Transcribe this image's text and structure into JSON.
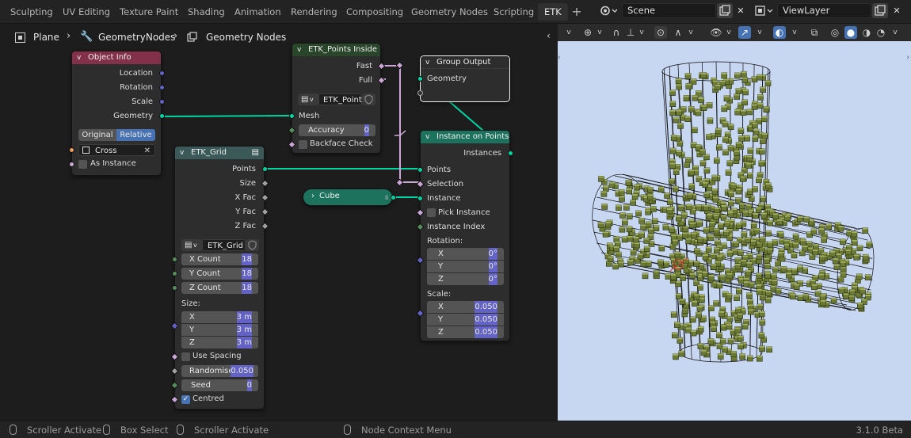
{
  "workspace_tabs": [
    "Sculpting",
    "UV Editing",
    "Texture Paint",
    "Shading",
    "Animation",
    "Rendering",
    "Compositing",
    "Geometry Nodes",
    "Scripting",
    "ETK"
  ],
  "active_tab": "ETK",
  "scene": {
    "name": "Scene"
  },
  "view_layer": {
    "name": "ViewLayer"
  },
  "breadcrumb": {
    "object": "Plane",
    "modifier": "GeometryNodes",
    "tree": "Geometry Nodes"
  },
  "nodes": {
    "object_info": {
      "title": "Object Info",
      "outputs": [
        "Location",
        "Rotation",
        "Scale",
        "Geometry"
      ],
      "mode_original": "Original",
      "mode_relative": "Relative",
      "object": "Cross",
      "as_instance": "As Instance"
    },
    "etk_points": {
      "title": "ETK_Points Inside ...",
      "out_fast": "Fast",
      "out_full": "Full",
      "group": "ETK_Point...",
      "mesh": "Mesh",
      "accuracy_label": "Accuracy",
      "accuracy_value": "0",
      "backface": "Backface Check"
    },
    "group_output": {
      "title": "Group Output",
      "geometry": "Geometry"
    },
    "etk_grid": {
      "title": "ETK_Grid",
      "outputs": [
        "Points",
        "Size",
        "X Fac",
        "Y Fac",
        "Z Fac"
      ],
      "group": "ETK_Grid",
      "x_count_label": "X Count",
      "x_count": "18",
      "y_count_label": "Y Count",
      "y_count": "18",
      "z_count_label": "Z Count",
      "z_count": "18",
      "size_label": "Size:",
      "sx_label": "X",
      "sx": "3 m",
      "sy_label": "Y",
      "sy": "3 m",
      "sz_label": "Z",
      "sz": "3 m",
      "use_spacing": "Use Spacing",
      "randomise_label": "Randomise",
      "randomise": "0.050",
      "seed_label": "Seed",
      "seed": "0",
      "centred": "Centred"
    },
    "cube": {
      "title": "Cube"
    },
    "instance_on_points": {
      "title": "Instance on Points",
      "instances": "Instances",
      "points": "Points",
      "selection": "Selection",
      "instance": "Instance",
      "pick_instance": "Pick Instance",
      "instance_index": "Instance Index",
      "rotation_label": "Rotation:",
      "rx_label": "X",
      "rx": "0°",
      "ry_label": "Y",
      "ry": "0°",
      "rz_label": "Z",
      "rz": "0°",
      "scale_label": "Scale:",
      "scx_label": "X",
      "scx": "0.050",
      "scy_label": "Y",
      "scy": "0.050",
      "scz_label": "Z",
      "scz": "0.050"
    }
  },
  "status": {
    "scroller1": "Scroller Activate",
    "box_select": "Box Select",
    "scroller2": "Scroller Activate",
    "node_context": "Node Context Menu",
    "version": "3.1.0 Beta"
  },
  "colors": {
    "object_info_header": "#83314a",
    "group_header": "#3b5959",
    "etk_points_header": "#29452a",
    "geometry_node_header": "#1d725e",
    "output_header": "#3c3c3c",
    "geometry_socket": "#00d6a3",
    "vector_socket": "#6363c7",
    "viewport_bg": "#c7d6f1",
    "cube_color": "#6b7a35"
  }
}
